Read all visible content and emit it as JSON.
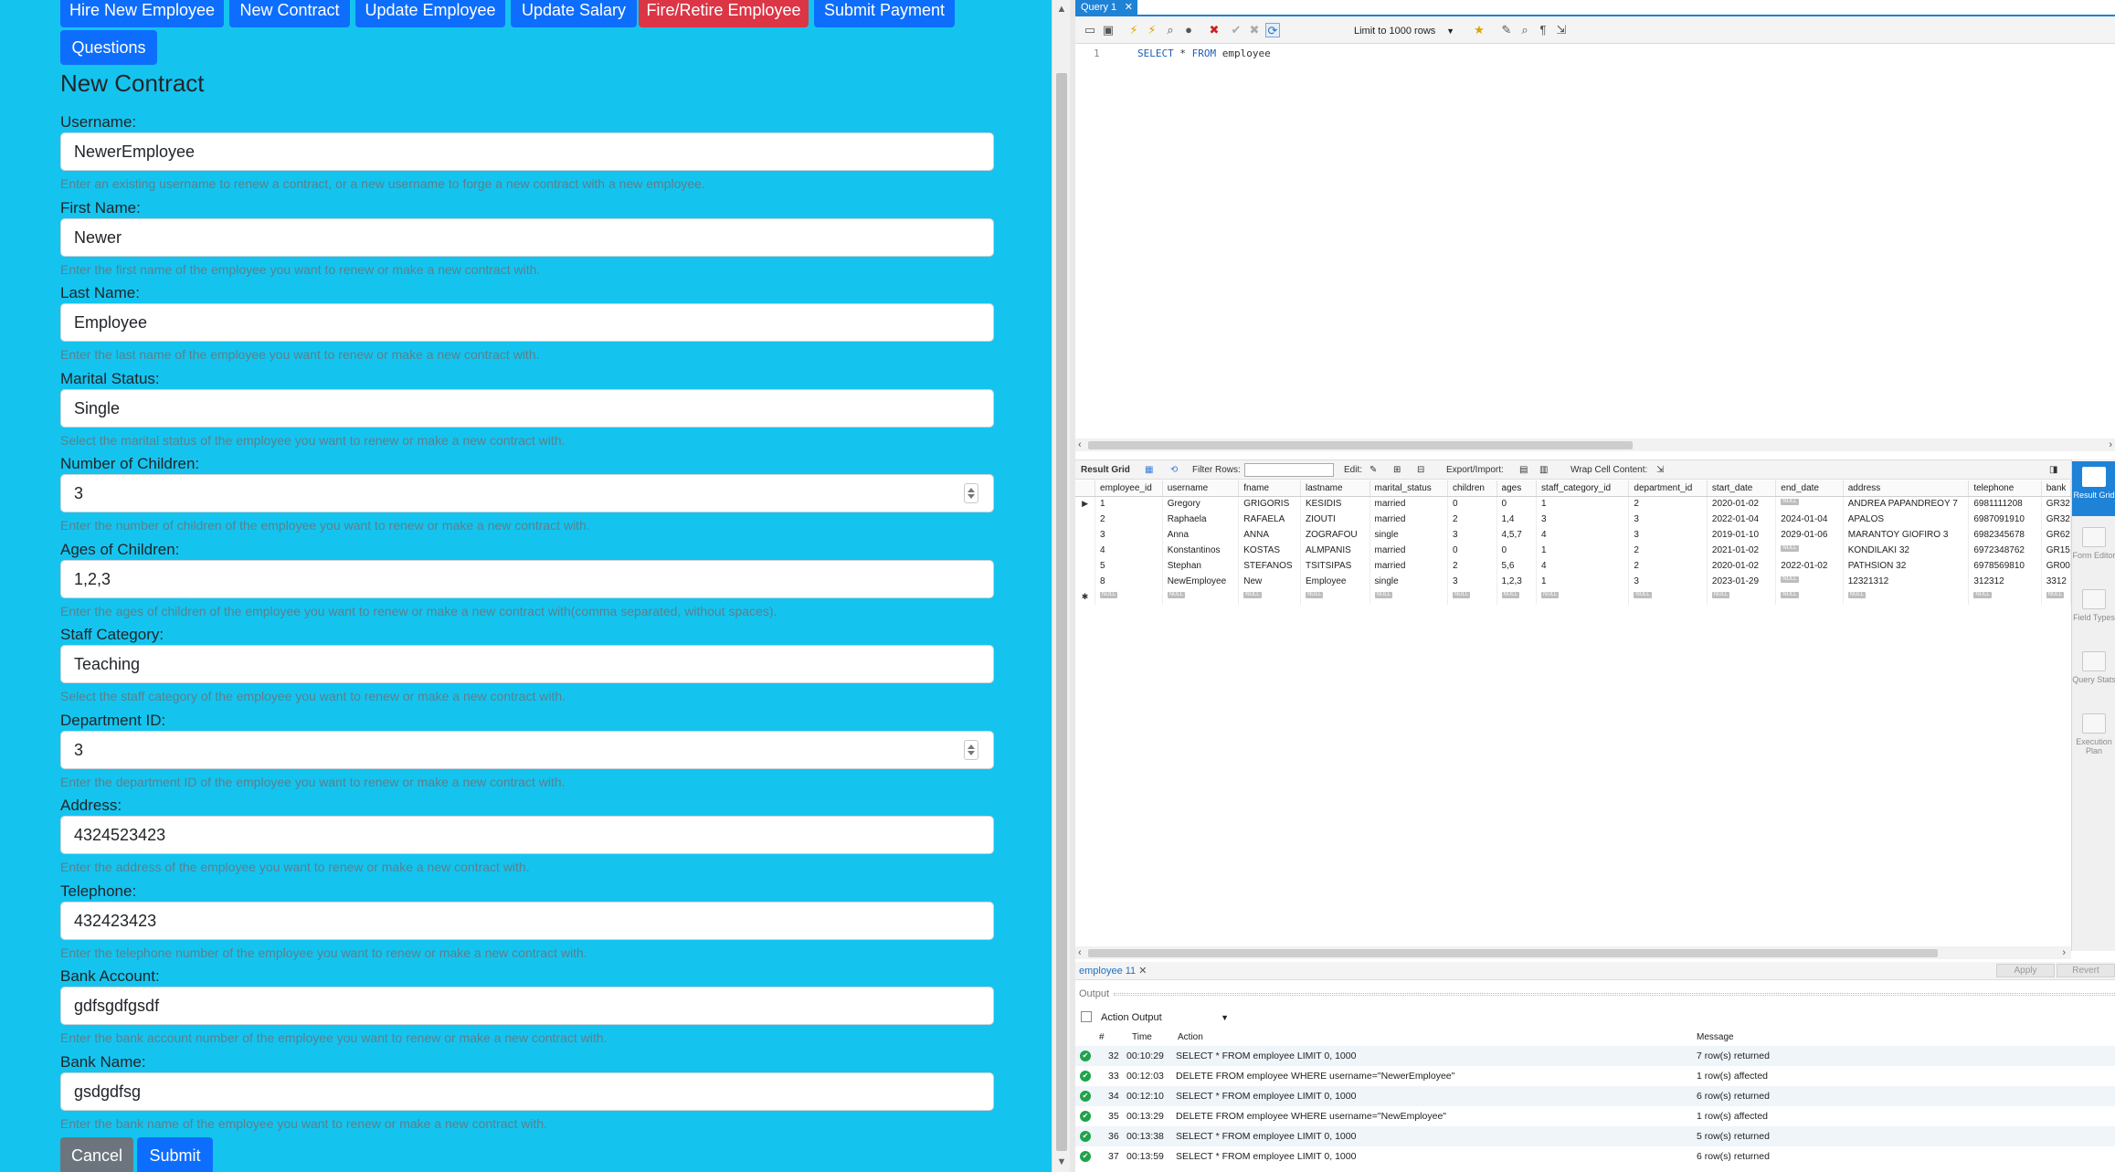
{
  "nav": {
    "buttons": [
      "Hire New Employee",
      "New Contract",
      "Update Employee",
      "Update Salary",
      "Fire/Retire Employee",
      "Submit Payment",
      "Questions"
    ]
  },
  "form": {
    "title": "New Contract",
    "fields": [
      {
        "label": "Username:",
        "value": "NewerEmployee",
        "help": "Enter an existing username to renew a contract, or a new username to forge a new contract with a new employee."
      },
      {
        "label": "First Name:",
        "value": "Newer",
        "help": "Enter the first name of the employee you want to renew or make a new contract with."
      },
      {
        "label": "Last Name:",
        "value": "Employee",
        "help": "Enter the last name of the employee you want to renew or make a new contract with."
      },
      {
        "label": "Marital Status:",
        "value": "Single",
        "help": "Select the marital status of the employee you want to renew or make a new contract with."
      },
      {
        "label": "Number of Children:",
        "value": "3",
        "help": "Enter the number of children of the employee you want to renew or make a new contract with."
      },
      {
        "label": "Ages of Children:",
        "value": "1,2,3",
        "help": "Enter the ages of children of the employee you want to renew or make a new contract with(comma separated, without spaces)."
      },
      {
        "label": "Staff Category:",
        "value": "Teaching",
        "help": "Select the staff category of the employee you want to renew or make a new contract with."
      },
      {
        "label": "Department ID:",
        "value": "3",
        "help": "Enter the department ID of the employee you want to renew or make a new contract with."
      },
      {
        "label": "Address:",
        "value": "4324523423",
        "help": "Enter the address of the employee you want to renew or make a new contract with."
      },
      {
        "label": "Telephone:",
        "value": "432423423",
        "help": "Enter the telephone number of the employee you want to renew or make a new contract with."
      },
      {
        "label": "Bank Account:",
        "value": "gdfsgdfgsdf",
        "help": "Enter the bank account number of the employee you want to renew or make a new contract with."
      },
      {
        "label": "Bank Name:",
        "value": "gsdgdfsg",
        "help": "Enter the bank name of the employee you want to renew or make a new contract with."
      }
    ],
    "cancel_label": "Cancel",
    "submit_label": "Submit"
  },
  "workbench": {
    "query_tab": "Query 1",
    "limit_label": "Limit to 1000 rows",
    "editor": {
      "line": "1",
      "kw1": "SELECT",
      "star": " * ",
      "kw2": "FROM",
      "table": " employee"
    },
    "result_bar": {
      "grid": "Result Grid",
      "filter": "Filter Rows:",
      "edit": "Edit:",
      "export": "Export/Import:",
      "wrap": "Wrap Cell Content:"
    },
    "columns": [
      "employee_id",
      "username",
      "fname",
      "lastname",
      "marital_status",
      "children",
      "ages",
      "staff_category_id",
      "department_id",
      "start_date",
      "end_date",
      "address",
      "telephone",
      "bank"
    ],
    "rows": [
      [
        "1",
        "Gregory",
        "GRIGORIS",
        "KESIDIS",
        "married",
        "0",
        "0",
        "1",
        "2",
        "2020-01-02",
        "NULL",
        "ANDREA PAPANDREOY 7",
        "6981111208",
        "GR32"
      ],
      [
        "2",
        "Raphaela",
        "RAFAELA",
        "ZIOUTI",
        "married",
        "2",
        "1,4",
        "3",
        "3",
        "2022-01-04",
        "2024-01-04",
        "APALOS",
        "6987091910",
        "GR32"
      ],
      [
        "3",
        "Anna",
        "ANNA",
        "ZOGRAFOU",
        "single",
        "3",
        "4,5,7",
        "4",
        "3",
        "2019-01-10",
        "2029-01-06",
        "MARANTOY GIOFIRO 3",
        "6982345678",
        "GR62"
      ],
      [
        "4",
        "Konstantinos",
        "KOSTAS",
        "ALMPANIS",
        "married",
        "0",
        "0",
        "1",
        "2",
        "2021-01-02",
        "NULL",
        "KONDILAKI 32",
        "6972348762",
        "GR15"
      ],
      [
        "5",
        "Stephan",
        "STEFANOS",
        "TSITSIPAS",
        "married",
        "2",
        "5,6",
        "4",
        "2",
        "2020-01-02",
        "2022-01-02",
        "PATHSION 32",
        "6978569810",
        "GR00"
      ],
      [
        "8",
        "NewEmployee",
        "New",
        "Employee",
        "single",
        "3",
        "1,2,3",
        "1",
        "3",
        "2023-01-29",
        "NULL",
        "12321312",
        "312312",
        "3312"
      ],
      [
        "NULL",
        "NULL",
        "NULL",
        "NULL",
        "NULL",
        "NULL",
        "NULL",
        "NULL",
        "NULL",
        "NULL",
        "NULL",
        "NULL",
        "NULL",
        "NULL"
      ]
    ],
    "side_panel": [
      "Result Grid",
      "Form Editor",
      "Field Types",
      "Query Stats",
      "Execution Plan"
    ],
    "result_tab": "employee 11",
    "apply_label": "Apply",
    "revert_label": "Revert",
    "output_label": "Output",
    "output_select": "Action Output",
    "output_headers": [
      "#",
      "Time",
      "Action",
      "Message"
    ],
    "output_rows": [
      [
        "32",
        "00:10:29",
        "SELECT * FROM employee LIMIT 0, 1000",
        "7 row(s) returned"
      ],
      [
        "33",
        "00:12:03",
        "DELETE FROM employee WHERE username=\"NewerEmployee\"",
        "1 row(s) affected"
      ],
      [
        "34",
        "00:12:10",
        "SELECT * FROM employee LIMIT 0, 1000",
        "6 row(s) returned"
      ],
      [
        "35",
        "00:13:29",
        "DELETE FROM employee WHERE username=\"NewEmployee\"",
        "1 row(s) affected"
      ],
      [
        "36",
        "00:13:38",
        "SELECT * FROM employee LIMIT 0, 1000",
        "5 row(s) returned"
      ],
      [
        "37",
        "00:13:59",
        "SELECT * FROM employee LIMIT 0, 1000",
        "6 row(s) returned"
      ]
    ]
  }
}
